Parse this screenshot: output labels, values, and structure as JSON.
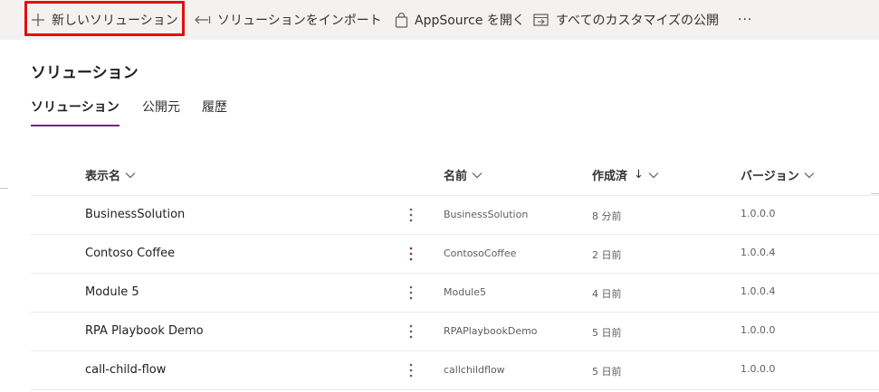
{
  "toolbar": {
    "new_solution": "新しいソリューション",
    "import_solution": "ソリューションをインポート",
    "open_appsource": "AppSource を開く",
    "publish_all": "すべてのカスタマイズの公開",
    "more": "···"
  },
  "page": {
    "title": "ソリューション"
  },
  "tabs": [
    "ソリューション",
    "公開元",
    "履歴"
  ],
  "columns": {
    "display_name": "表示名",
    "name": "名前",
    "created": "作成済",
    "created_sort": "↓",
    "version": "バージョン"
  },
  "rows": [
    {
      "display_name": "BusinessSolution",
      "name": "BusinessSolution",
      "created": "8 分前",
      "version": "1.0.0.0"
    },
    {
      "display_name": "Contoso Coffee",
      "name": "ContosoCoffee",
      "created": "2 日前",
      "version": "1.0.0.4"
    },
    {
      "display_name": "Module 5",
      "name": "Module5",
      "created": "4 日前",
      "version": "1.0.0.4"
    },
    {
      "display_name": "RPA Playbook Demo",
      "name": "RPAPlaybookDemo",
      "created": "5 日前",
      "version": "1.0.0.0"
    },
    {
      "display_name": "call-child-flow",
      "name": "callchildflow",
      "created": "5 日前",
      "version": "1.0.0.0"
    }
  ],
  "colors": {
    "accent": "#742774",
    "highlight": "#e10f0f",
    "toolbar_bg": "#f3f2f1"
  },
  "icons": {
    "new_solution": "plus-icon",
    "import_solution": "import-arrow-icon",
    "open_appsource": "shopping-bag-icon",
    "publish_all": "publish-icon",
    "row_menu": "kebab-icon",
    "column_menu": "chevron-down-icon"
  }
}
